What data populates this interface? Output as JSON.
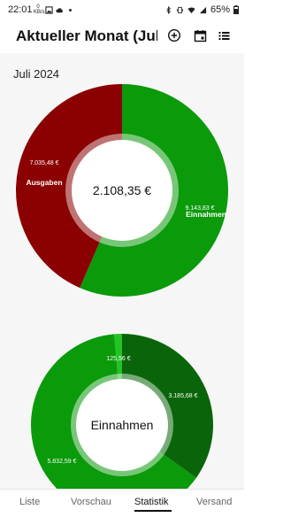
{
  "status_bar": {
    "time": "22:01",
    "data_label": "0 KB/s",
    "battery": "65%"
  },
  "app_bar": {
    "title": "Aktueller Monat (Juli…",
    "icons": [
      "add-circle-icon",
      "calendar-icon",
      "list-icon"
    ]
  },
  "main": {
    "month_label": "Juli 2024",
    "summary_donut": {
      "center_label": "2.108,35 €",
      "segments": [
        {
          "name": "Ausgaben",
          "amount": "7.035,48 €",
          "value": 7035.48,
          "color": "#8b0000"
        },
        {
          "name": "Einnahmen",
          "amount": "9.143,83 €",
          "value": 9143.83,
          "color": "#0a9a0a"
        }
      ]
    },
    "income_donut": {
      "center_label": "Einnahmen",
      "segments": [
        {
          "amount": "3.185,68 €",
          "value": 3185.68,
          "color": "#0a650a"
        },
        {
          "amount": "5.832,59 €",
          "value": 5832.59,
          "color": "#0a9a0a"
        },
        {
          "amount": "125,56 €",
          "value": 125.56,
          "color": "#22c322"
        }
      ]
    }
  },
  "bottom_nav": {
    "items": [
      "Liste",
      "Vorschau",
      "Statistik",
      "Versand"
    ],
    "active": "Statistik"
  }
}
